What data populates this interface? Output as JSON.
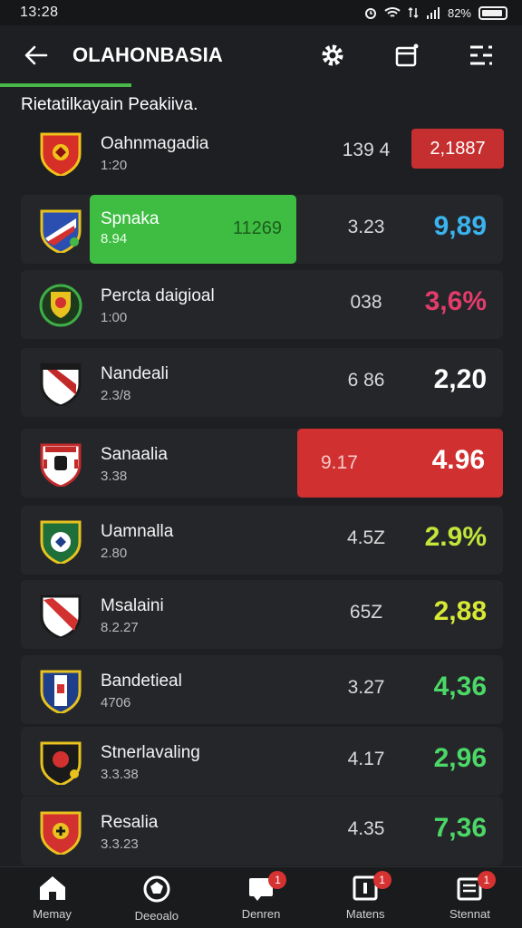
{
  "status": {
    "time": "13:28",
    "battery": "82%"
  },
  "app_bar": {
    "title": "OLAHONBASIA"
  },
  "section": {
    "title": "Rietatilkayain Peakiiva."
  },
  "rows": [
    {
      "name": "Oahnmagadia",
      "sub": "1:20",
      "mid": "139 4",
      "main": "2,1887",
      "main_color": "#ffffff",
      "style": "red-pill-top"
    },
    {
      "name": "Spnaka",
      "sub": "8.94",
      "green_val": "11269",
      "mid": "3.23",
      "main": "9,89",
      "main_color": "#3bb3ef",
      "style": "green"
    },
    {
      "name": "Percta daigioal",
      "sub": "1:00",
      "mid": "038",
      "main": "3,6%",
      "main_color": "#e23c6b",
      "style": "plain"
    },
    {
      "name": "Nandeali",
      "sub": "2.3/8",
      "mid": "6 86",
      "main": "2,20",
      "main_color": "#ffffff",
      "style": "plain"
    },
    {
      "name": "Sanaalia",
      "sub": "3.38",
      "red_val": "9.17",
      "main": "4.96",
      "main_color": "#ffffff",
      "style": "red"
    },
    {
      "name": "Uamnalla",
      "sub": "2.80",
      "mid": "4.5Z",
      "main": "2.9%",
      "main_color": "#c3e63a",
      "style": "plain"
    },
    {
      "name": "Msalaini",
      "sub": "8.2.27",
      "mid": "65Z",
      "main": "2,88",
      "main_color": "#d7e935",
      "style": "plain"
    },
    {
      "name": "Bandetieal",
      "sub": "4706",
      "mid": "3.27",
      "main": "4,36",
      "main_color": "#4cd866",
      "style": "plain"
    },
    {
      "name": "Stnerlavaling",
      "sub": "3.3.38",
      "mid": "4.17",
      "main": "2,96",
      "main_color": "#4cd866",
      "style": "plain"
    },
    {
      "name": "Resalia",
      "sub": "3.3.23",
      "mid": "4.35",
      "main": "7,36",
      "main_color": "#4cd866",
      "style": "plain"
    }
  ],
  "bottom_nav": [
    {
      "label": "Memay",
      "icon": "home-icon",
      "badge": ""
    },
    {
      "label": "Deeoalo",
      "icon": "ball-icon",
      "badge": ""
    },
    {
      "label": "Denren",
      "icon": "chat-icon",
      "badge": "1"
    },
    {
      "label": "Matens",
      "icon": "info-icon",
      "badge": "1"
    },
    {
      "label": "Stennat",
      "icon": "list-icon",
      "badge": "1"
    }
  ],
  "colors": {
    "accent_green": "#49b849",
    "pill_red": "#c62f30",
    "background": "#1d1f22",
    "row_bg": "#24262a"
  }
}
